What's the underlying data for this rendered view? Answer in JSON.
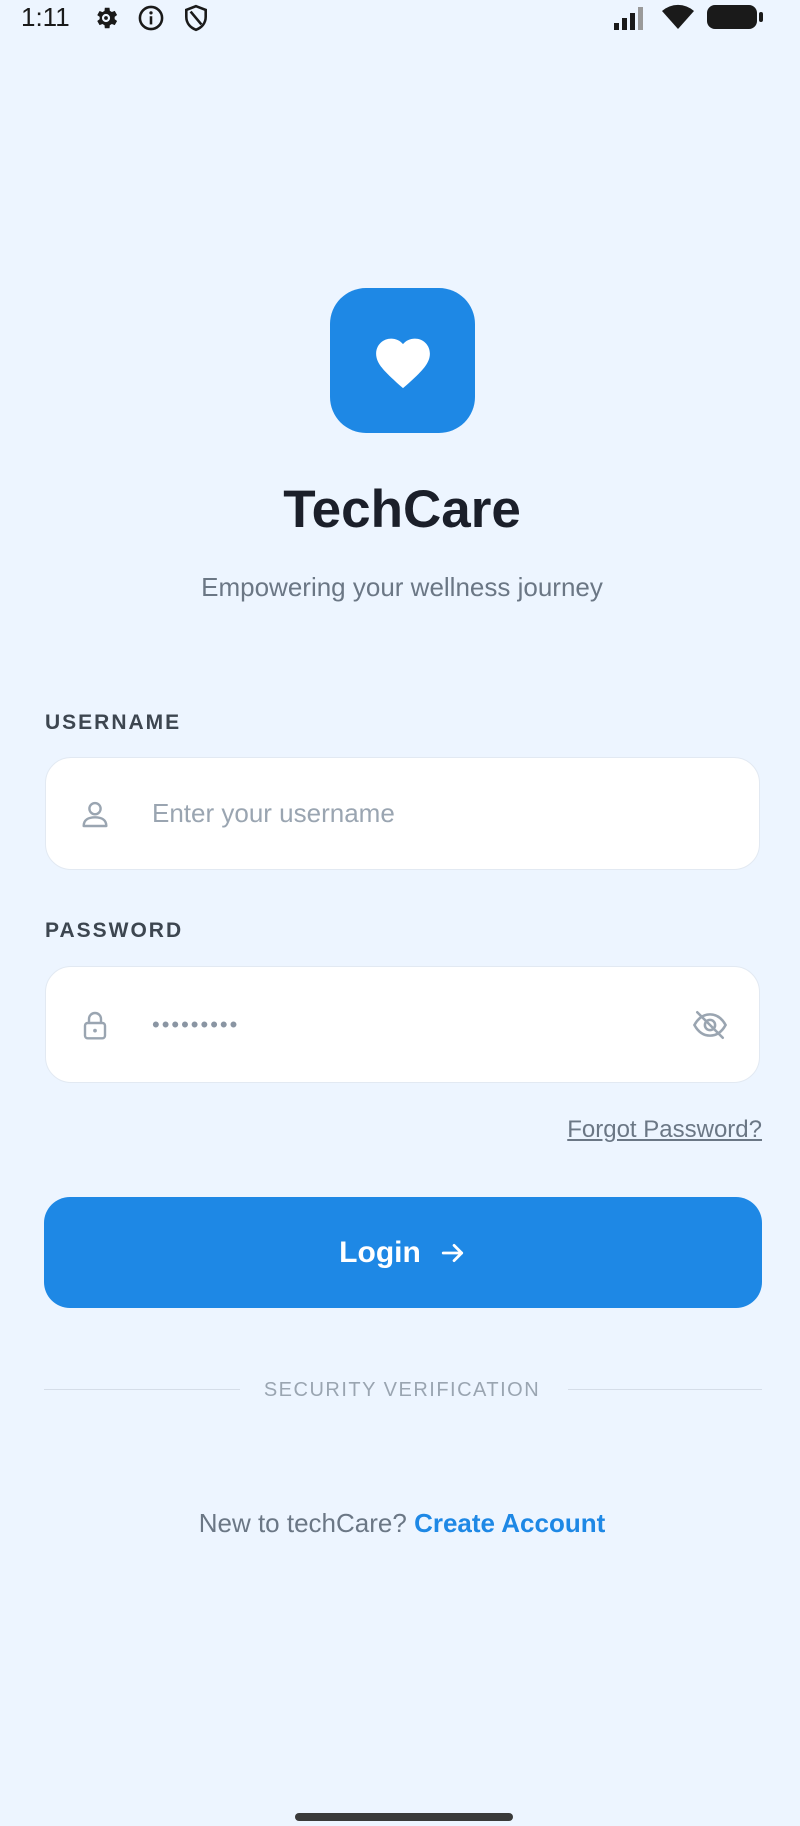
{
  "status_bar": {
    "time": "1:11",
    "left_icons": [
      "gear-icon",
      "info-icon",
      "shield-icon"
    ],
    "right_icons": [
      "signal-icon",
      "wifi-icon",
      "battery-icon"
    ]
  },
  "brand": {
    "logo_icon": "heart-icon",
    "logo_color": "#1e88e5",
    "title": "TechCare",
    "subtitle": "Empowering your wellness journey"
  },
  "form": {
    "username": {
      "label": "USERNAME",
      "placeholder": "Enter your username",
      "value": "",
      "icon": "user-icon"
    },
    "password": {
      "label": "PASSWORD",
      "value": "•••••••••",
      "icon": "lock-icon",
      "toggle_icon": "eye-off-icon"
    },
    "forgot_password_label": "Forgot Password?",
    "login_label": "Login",
    "login_icon": "arrow-right-icon",
    "divider_label": "SECURITY VERIFICATION"
  },
  "signup": {
    "prompt": "New to techCare?",
    "link_label": "Create Account"
  },
  "colors": {
    "background": "#edf5ff",
    "accent": "#1e88e5",
    "text_primary": "#1b1f2a",
    "text_muted": "#6b7785"
  }
}
